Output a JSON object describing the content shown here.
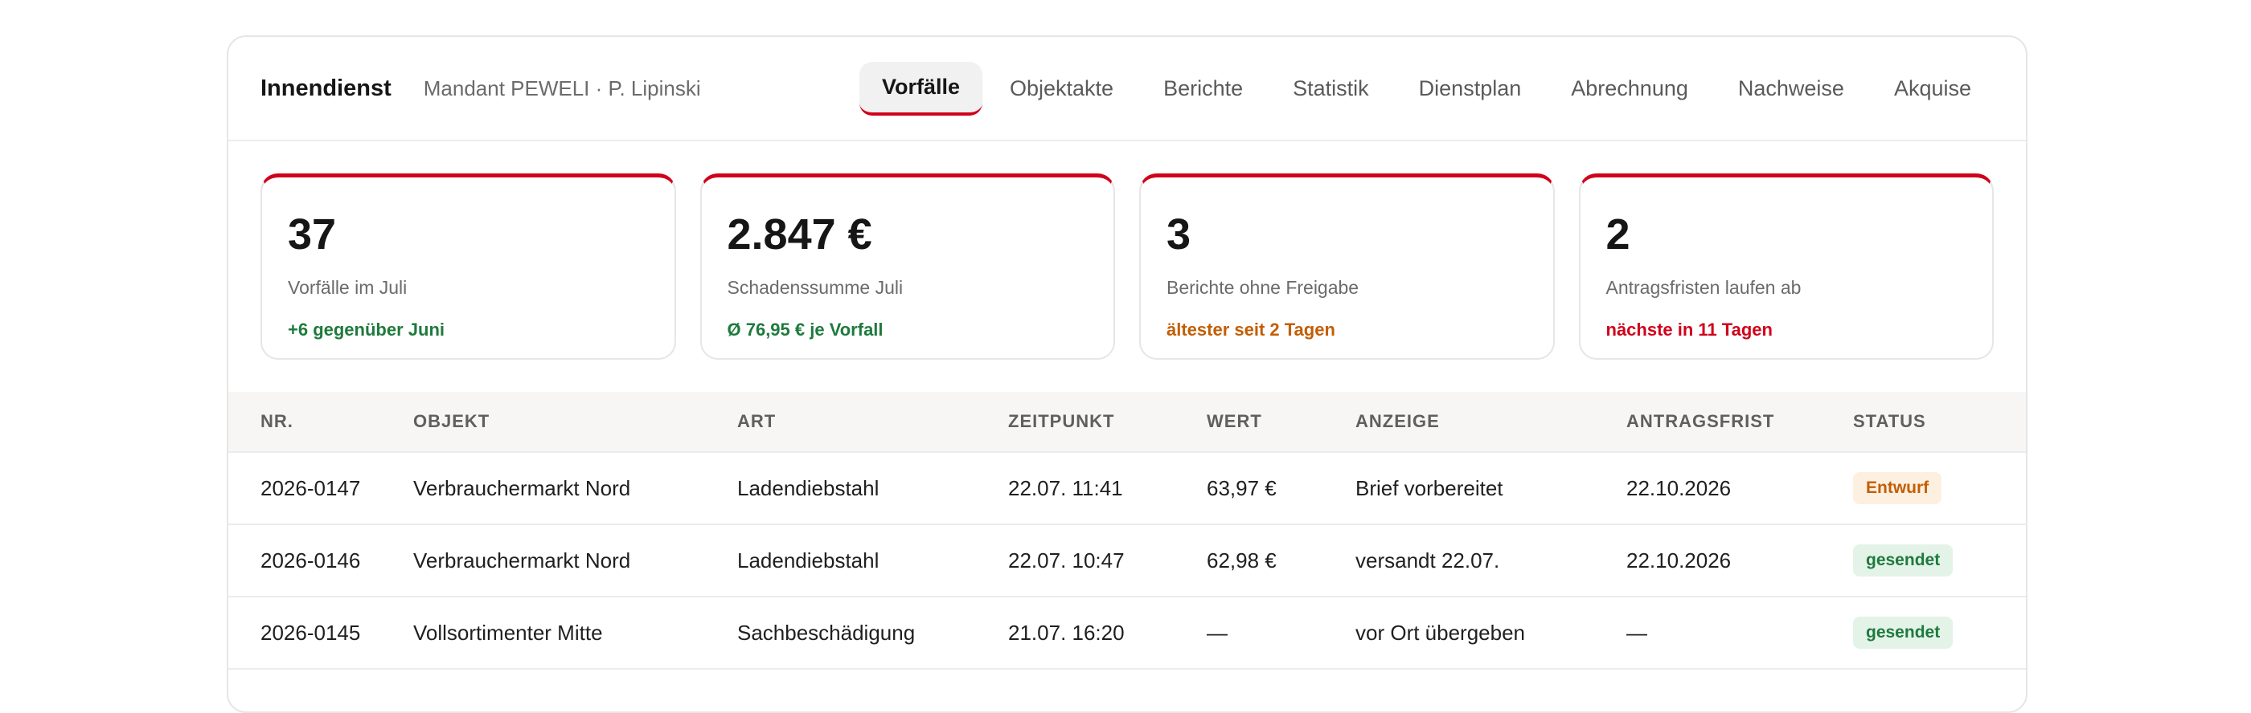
{
  "header": {
    "brand": "Innendienst",
    "client": "Mandant PEWELI · P. Lipinski",
    "tabs": [
      {
        "label": "Vorfälle",
        "active": true
      },
      {
        "label": "Objektakte",
        "active": false
      },
      {
        "label": "Berichte",
        "active": false
      },
      {
        "label": "Statistik",
        "active": false
      },
      {
        "label": "Dienstplan",
        "active": false
      },
      {
        "label": "Abrechnung",
        "active": false
      },
      {
        "label": "Nachweise",
        "active": false
      },
      {
        "label": "Akquise",
        "active": false
      }
    ]
  },
  "kpis": [
    {
      "value": "37",
      "label": "Vorfälle im Juli",
      "note": "+6 gegenüber Juni",
      "tone": "green"
    },
    {
      "value": "2.847 €",
      "label": "Schadenssumme Juli",
      "note": "Ø 76,95 € je Vorfall",
      "tone": "green"
    },
    {
      "value": "3",
      "label": "Berichte ohne Freigabe",
      "note": "ältester seit 2 Tagen",
      "tone": "orange"
    },
    {
      "value": "2",
      "label": "Antragsfristen laufen ab",
      "note": "nächste in 11 Tagen",
      "tone": "red"
    }
  ],
  "table": {
    "columns": [
      "NR.",
      "OBJEKT",
      "ART",
      "ZEITPUNKT",
      "WERT",
      "ANZEIGE",
      "ANTRAGSFRIST",
      "STATUS"
    ],
    "rows": [
      {
        "nr": "2026-0147",
        "objekt": "Verbrauchermarkt Nord",
        "art": "Ladendiebstahl",
        "zeitpunkt": "22.07. 11:41",
        "wert": "63,97 €",
        "anzeige": "Brief vorbereitet",
        "frist": "22.10.2026",
        "status": "Entwurf",
        "status_kind": "draft"
      },
      {
        "nr": "2026-0146",
        "objekt": "Verbrauchermarkt Nord",
        "art": "Ladendiebstahl",
        "zeitpunkt": "22.07. 10:47",
        "wert": "62,98 €",
        "anzeige": "versandt 22.07.",
        "frist": "22.10.2026",
        "status": "gesendet",
        "status_kind": "sent"
      },
      {
        "nr": "2026-0145",
        "objekt": "Vollsortimenter Mitte",
        "art": "Sachbeschädigung",
        "zeitpunkt": "21.07. 16:20",
        "wert": "—",
        "anzeige": "vor Ort übergeben",
        "frist": "—",
        "status": "gesendet",
        "status_kind": "sent"
      }
    ]
  },
  "colors": {
    "accent": "#d0021b",
    "positive": "#1e7a3d",
    "warning": "#c25e05"
  }
}
